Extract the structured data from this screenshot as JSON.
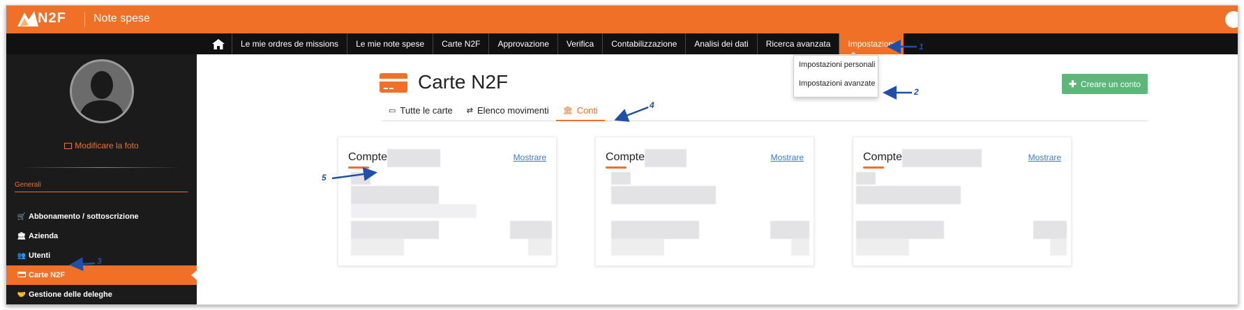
{
  "app": {
    "brand": "N2F",
    "title": "Note spese"
  },
  "nav": {
    "home_icon": "home-icon",
    "items": [
      "Le mie ordres de missions",
      "Le mie note spese",
      "Carte N2F",
      "Approvazione",
      "Verifica",
      "Contabilizzazione",
      "Analisi dei dati",
      "Ricerca avanzata",
      "Impostazioni"
    ],
    "active": "Impostazioni"
  },
  "dropdown": {
    "items": [
      "Impostazioni personali",
      "Impostazioni avanzate"
    ]
  },
  "sidebar": {
    "photo_link": "Modificare la foto",
    "section": "Generali",
    "items": [
      {
        "label": "Abbonamento / sottoscrizione",
        "icon": "cart-icon"
      },
      {
        "label": "Azienda",
        "icon": "bank-icon"
      },
      {
        "label": "Utenti",
        "icon": "users-icon"
      },
      {
        "label": "Carte N2F",
        "icon": "credit-card-icon",
        "active": true
      },
      {
        "label": "Gestione delle deleghe",
        "icon": "handshake-icon"
      }
    ]
  },
  "page": {
    "title": "Carte N2F",
    "create_button": "Creare un conto"
  },
  "tabs": [
    {
      "label": "Tutte le carte",
      "icon": "credit-card-icon"
    },
    {
      "label": "Elenco movimenti",
      "icon": "exchange-icon"
    },
    {
      "label": "Conti",
      "icon": "bank-icon",
      "active": true
    }
  ],
  "cards": [
    {
      "title": "Compte",
      "link": "Mostrare"
    },
    {
      "title": "Compte",
      "link": "Mostrare"
    },
    {
      "title": "Compte",
      "link": "Mostrare"
    }
  ],
  "annotations": [
    "1",
    "2",
    "3",
    "4",
    "5"
  ],
  "colors": {
    "accent": "#ef7026",
    "navbar": "#111111",
    "sidebar": "#1b1b1b",
    "create_button": "#5cb87a",
    "link": "#3a7bd5",
    "annotation": "#1f4fa8"
  }
}
